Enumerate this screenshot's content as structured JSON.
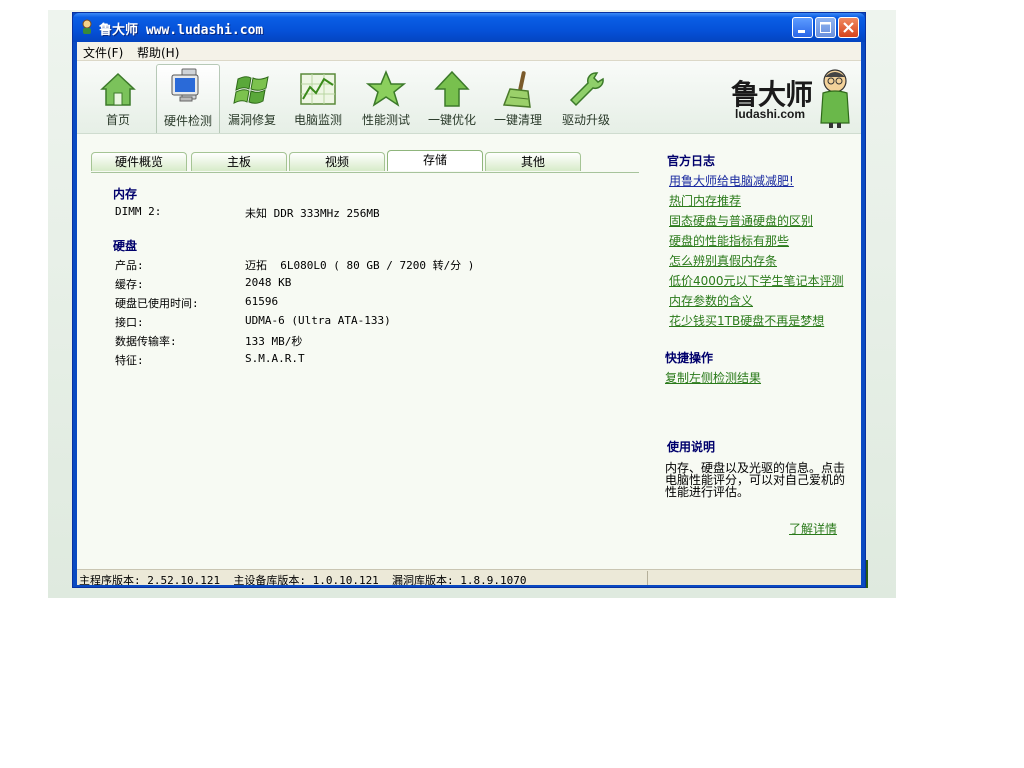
{
  "window": {
    "title": "鲁大师 www.ludashi.com"
  },
  "menu": [
    {
      "label": "文件(F)"
    },
    {
      "label": "帮助(H)"
    }
  ],
  "toolbar": [
    {
      "label": "首页",
      "icon": "home-icon"
    },
    {
      "label": "硬件检测",
      "icon": "monitor-icon",
      "active": true
    },
    {
      "label": "漏洞修复",
      "icon": "windows-flag-icon"
    },
    {
      "label": "电脑监测",
      "icon": "chart-icon"
    },
    {
      "label": "性能测试",
      "icon": "star-icon"
    },
    {
      "label": "一键优化",
      "icon": "up-arrow-icon"
    },
    {
      "label": "一键清理",
      "icon": "broom-icon"
    },
    {
      "label": "驱动升级",
      "icon": "wrench-icon"
    }
  ],
  "brand": {
    "name_cn": "鲁大师",
    "name_en": "ludashi.com"
  },
  "tabs": [
    {
      "label": "硬件概览"
    },
    {
      "label": "主板"
    },
    {
      "label": "视频"
    },
    {
      "label": "存储",
      "active": true
    },
    {
      "label": "其他"
    }
  ],
  "memory": {
    "title": "内存",
    "rows": [
      {
        "label": "DIMM 2:",
        "value": "未知 DDR 333MHz 256MB"
      }
    ]
  },
  "disk": {
    "title": "硬盘",
    "rows": [
      {
        "label": "产品:",
        "value": "迈拓  6L080L0 ( 80 GB / 7200 转/分 )"
      },
      {
        "label": "缓存:",
        "value": "2048 KB"
      },
      {
        "label": "硬盘已使用时间:",
        "value": "61596"
      },
      {
        "label": "接口:",
        "value": "UDMA-6 (Ultra ATA-133)"
      },
      {
        "label": "数据传输率:",
        "value": "133 MB/秒"
      },
      {
        "label": "特征:",
        "value": "S.M.A.R.T"
      }
    ]
  },
  "sidebar": {
    "blog_title": "官方日志",
    "blog_links": [
      "用鲁大师给电脑减减肥!",
      "热门内存推荐",
      "固态硬盘与普通硬盘的区别",
      "硬盘的性能指标有那些",
      "怎么辨别真假内存条",
      "低价4000元以下学生笔记本评测",
      "内存参数的含义",
      "花少钱买1TB硬盘不再是梦想"
    ],
    "quick_title": "快捷操作",
    "quick_link": "复制左侧检测结果",
    "usage_title": "使用说明",
    "usage_text": "内存、硬盘以及光驱的信息。点击电脑性能评分，可以对自己爱机的性能进行评估。",
    "more_link": "了解详情"
  },
  "status": {
    "text": "主程序版本: 2.52.10.121  主设备库版本: 1.0.10.121  漏洞库版本: 1.8.9.1070"
  }
}
